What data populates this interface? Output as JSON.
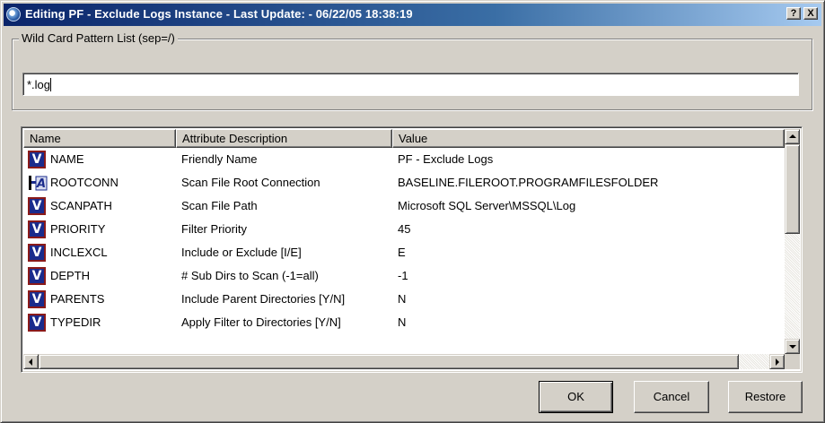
{
  "window": {
    "title": "Editing PF - Exclude Logs Instance - Last Update: - 06/22/05 18:38:19",
    "help_label": "?",
    "close_label": "X",
    "title_icon": "app-gear-icon"
  },
  "pattern": {
    "legend": "Wild Card Pattern List (sep=/)",
    "value": "*.log"
  },
  "table": {
    "columns": [
      "Name",
      "Attribute Description",
      "Value"
    ],
    "rows": [
      {
        "icon": "v",
        "name": "NAME",
        "description": "Friendly Name",
        "value": "PF - Exclude Logs"
      },
      {
        "icon": "conn",
        "name": "ROOTCONN",
        "description": "Scan File Root Connection",
        "value": "BASELINE.FILEROOT.PROGRAMFILESFOLDER"
      },
      {
        "icon": "v",
        "name": "SCANPATH",
        "description": "Scan File Path",
        "value": "Microsoft SQL Server\\MSSQL\\Log"
      },
      {
        "icon": "v",
        "name": "PRIORITY",
        "description": "Filter Priority",
        "value": "45"
      },
      {
        "icon": "v",
        "name": "INCLEXCL",
        "description": "Include or Exclude [I/E]",
        "value": "E"
      },
      {
        "icon": "v",
        "name": "DEPTH",
        "description": "# Sub Dirs to Scan (-1=all)",
        "value": "-1"
      },
      {
        "icon": "v",
        "name": "PARENTS",
        "description": "Include Parent Directories [Y/N]",
        "value": "N"
      },
      {
        "icon": "v",
        "name": "TYPEDIR",
        "description": "Apply Filter to Directories [Y/N]",
        "value": "N"
      }
    ]
  },
  "icon_labels": {
    "variable_icon": "V",
    "connection_icon": "A"
  },
  "buttons": {
    "ok": "OK",
    "cancel": "Cancel",
    "restore": "Restore"
  },
  "colors": {
    "title_start": "#0a246a",
    "title_end": "#a6caf0",
    "face": "#d4d0c8",
    "variable_icon_bg": "#1a2b8c",
    "variable_icon_border": "#8a1a1a"
  }
}
